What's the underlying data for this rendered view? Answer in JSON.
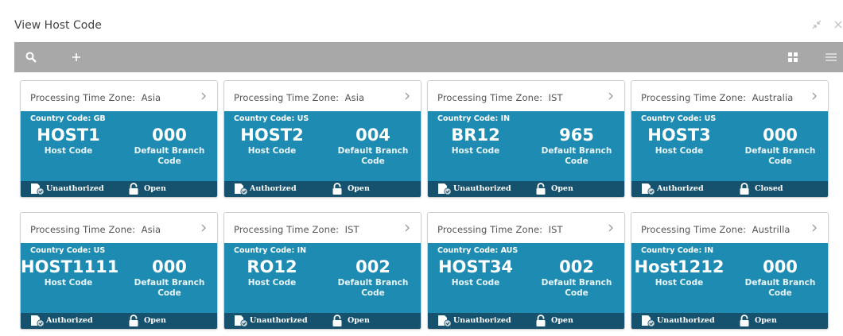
{
  "window": {
    "title": "View Host Code"
  },
  "toolbar": {
    "search_icon": "search-icon",
    "add_icon": "plus-icon",
    "tile_view_icon": "grid-icon",
    "list_view_icon": "list-icon"
  },
  "labels": {
    "tz_prefix": "Processing Time Zone:",
    "cc_prefix": "Country Code:",
    "host_code": "Host Code",
    "branch_line1": "Default Branch",
    "branch_line2": "Code"
  },
  "colors": {
    "card_body": "#1e8bb3",
    "card_footer": "#16526e",
    "toolbar": "#a8a8a8"
  },
  "cards": [
    {
      "tz": "Asia",
      "country": "GB",
      "host": "HOST1",
      "branch": "000",
      "auth": "Unauthorized",
      "status": "Open"
    },
    {
      "tz": "Asia",
      "country": "US",
      "host": "HOST2",
      "branch": "004",
      "auth": "Authorized",
      "status": "Open"
    },
    {
      "tz": "IST",
      "country": "IN",
      "host": "BR12",
      "branch": "965",
      "auth": "Unauthorized",
      "status": "Open"
    },
    {
      "tz": "Australia",
      "country": "US",
      "host": "HOST3",
      "branch": "000",
      "auth": "Authorized",
      "status": "Closed"
    },
    {
      "tz": "Asia",
      "country": "US",
      "host": "HOST1111",
      "branch": "000",
      "auth": "Authorized",
      "status": "Open"
    },
    {
      "tz": "IST",
      "country": "IN",
      "host": "RO12",
      "branch": "002",
      "auth": "Unauthorized",
      "status": "Open"
    },
    {
      "tz": "IST",
      "country": "AUS",
      "host": "HOST34",
      "branch": "002",
      "auth": "Unauthorized",
      "status": "Open"
    },
    {
      "tz": "Austrilla",
      "country": "IN",
      "host": "Host1212",
      "branch": "000",
      "auth": "Unauthorized",
      "status": "Open"
    }
  ]
}
